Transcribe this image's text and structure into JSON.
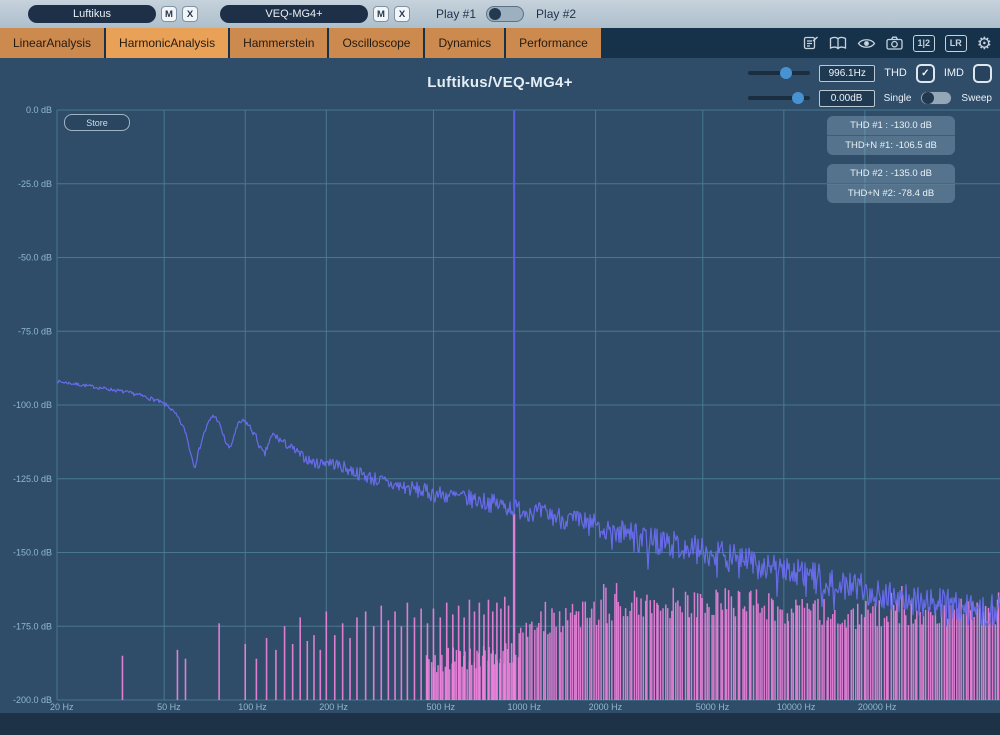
{
  "topbar": {
    "slot1": "Luftikus",
    "slot1_mute": "M",
    "slot1_close": "X",
    "slot2": "VEQ-MG4+",
    "slot2_mute": "M",
    "slot2_close": "X",
    "play1": "Play #1",
    "play2": "Play #2"
  },
  "tabs": {
    "t0": "LinearAnalysis",
    "t1": "HarmonicAnalysis",
    "t2": "Hammerstein",
    "t3": "Oscilloscope",
    "t4": "Dynamics",
    "t5": "Performance"
  },
  "toolbar": {
    "compare": "1|2",
    "channels": "LR",
    "gear": "⚙"
  },
  "header": {
    "title": "Luftikus/VEQ-MG4+"
  },
  "controls": {
    "freq": "996.1Hz",
    "thd": "THD",
    "thd_check": "✓",
    "imd": "IMD",
    "level": "0.00dB",
    "single": "Single",
    "sweep": "Sweep",
    "store": "Store"
  },
  "measurements": {
    "b1l1": "THD #1 : -130.0 dB",
    "b1l2": "THD+N #1: -106.5 dB",
    "b2l1": "THD #2 : -135.0 dB",
    "b2l2": "THD+N #2: -78.4 dB"
  },
  "colors": {
    "bg": "#2f4d69",
    "grid": "#4a7d96",
    "axis_text": "#8fb9cc",
    "curve": "#6b6df0",
    "spike": "#5a5ce8",
    "harmonics": "#ee82dc",
    "accent": "#e8a157"
  },
  "chart_data": {
    "type": "line",
    "title": "Luftikus/VEQ-MG4+",
    "x_axis": {
      "scale": "log",
      "unit": "Hz",
      "min": 20,
      "max": 63000,
      "ticks": [
        {
          "f": 20,
          "label": "20 Hz"
        },
        {
          "f": 50,
          "label": "50 Hz"
        },
        {
          "f": 100,
          "label": "100 Hz"
        },
        {
          "f": 200,
          "label": "200 Hz"
        },
        {
          "f": 500,
          "label": "500 Hz"
        },
        {
          "f": 1000,
          "label": "1000 Hz"
        },
        {
          "f": 2000,
          "label": "2000 Hz"
        },
        {
          "f": 5000,
          "label": "5000 Hz"
        },
        {
          "f": 10000,
          "label": "10000 Hz"
        },
        {
          "f": 20000,
          "label": "20000 Hz"
        }
      ]
    },
    "y_axis": {
      "unit": "dB",
      "min": -200,
      "max": 0,
      "step": 25,
      "ticks": [
        {
          "db": 0,
          "label": "0.0 dB"
        },
        {
          "db": -25,
          "label": "-25.0 dB"
        },
        {
          "db": -50,
          "label": "-50.0 dB"
        },
        {
          "db": -75,
          "label": "-75.0 dB"
        },
        {
          "db": -100,
          "label": "-100.0 dB"
        },
        {
          "db": -125,
          "label": "-125.0 dB"
        },
        {
          "db": -150,
          "label": "-150.0 dB"
        },
        {
          "db": -175,
          "label": "-175.0 dB"
        },
        {
          "db": -200,
          "label": "-200.0 dB"
        }
      ]
    },
    "fundamental": {
      "freq_hz": 996.1,
      "top_db": 0,
      "color": "#5a5ce8"
    },
    "noise_floor": {
      "color": "#6b6df0",
      "seed": 7,
      "envelope_db_points": [
        [
          20,
          -92
        ],
        [
          26,
          -93.5
        ],
        [
          33,
          -95
        ],
        [
          40,
          -96.5
        ],
        [
          47,
          -98.5
        ],
        [
          52,
          -100.5
        ],
        [
          56,
          -104
        ],
        [
          60,
          -109
        ],
        [
          63,
          -117
        ],
        [
          65,
          -121
        ],
        [
          67,
          -116
        ],
        [
          70,
          -110
        ],
        [
          73,
          -106
        ],
        [
          76,
          -103.5
        ],
        [
          79,
          -105
        ],
        [
          82,
          -109
        ],
        [
          85,
          -113
        ],
        [
          88,
          -115
        ],
        [
          91,
          -110
        ],
        [
          95,
          -106
        ],
        [
          100,
          -105.5
        ],
        [
          105,
          -108
        ],
        [
          110,
          -111
        ],
        [
          114,
          -115
        ],
        [
          118,
          -117
        ],
        [
          122,
          -113
        ],
        [
          127,
          -110
        ],
        [
          133,
          -111.5
        ],
        [
          140,
          -113
        ],
        [
          148,
          -114.5
        ],
        [
          158,
          -116.5
        ],
        [
          170,
          -118.5
        ],
        [
          185,
          -120
        ],
        [
          200,
          -119
        ],
        [
          230,
          -121
        ],
        [
          260,
          -123
        ],
        [
          300,
          -125
        ],
        [
          350,
          -127
        ],
        [
          420,
          -128.5
        ],
        [
          500,
          -130
        ],
        [
          600,
          -131
        ],
        [
          750,
          -132.5
        ],
        [
          900,
          -134
        ],
        [
          1000,
          -135
        ],
        [
          1300,
          -137
        ],
        [
          1700,
          -139.5
        ],
        [
          2000,
          -141
        ],
        [
          2600,
          -143.5
        ],
        [
          3300,
          -146
        ],
        [
          4200,
          -148
        ],
        [
          5000,
          -149.5
        ],
        [
          6500,
          -152
        ],
        [
          8000,
          -154
        ],
        [
          10000,
          -156
        ],
        [
          13000,
          -158.5
        ],
        [
          16000,
          -160.5
        ],
        [
          20000,
          -162.5
        ],
        [
          26000,
          -165
        ],
        [
          33000,
          -166.5
        ],
        [
          42000,
          -168
        ],
        [
          52000,
          -169
        ],
        [
          63000,
          -170
        ]
      ],
      "noise_amp_points": [
        [
          20,
          0.5
        ],
        [
          80,
          0.8
        ],
        [
          150,
          1.5
        ],
        [
          300,
          2.5
        ],
        [
          600,
          3
        ],
        [
          1200,
          3.5
        ],
        [
          3000,
          4.5
        ],
        [
          8000,
          5
        ],
        [
          63000,
          5.5
        ]
      ],
      "dip_chance": 0.12,
      "dip_max_db": 8,
      "dip_above_hz": 1800
    },
    "harmonics": {
      "color": "#ee82dc",
      "spikes": [
        [
          35,
          -185
        ],
        [
          56,
          -183
        ],
        [
          60,
          -186
        ],
        [
          80,
          -174
        ],
        [
          100,
          -181
        ],
        [
          110,
          -186
        ],
        [
          120,
          -179
        ],
        [
          130,
          -183
        ],
        [
          140,
          -175
        ],
        [
          150,
          -181
        ],
        [
          160,
          -172
        ],
        [
          170,
          -180
        ],
        [
          180,
          -178
        ],
        [
          190,
          -183
        ],
        [
          200,
          -170
        ],
        [
          215,
          -178
        ],
        [
          230,
          -174
        ],
        [
          245,
          -179
        ],
        [
          260,
          -172
        ],
        [
          280,
          -170
        ],
        [
          300,
          -175
        ],
        [
          320,
          -168
        ],
        [
          340,
          -173
        ],
        [
          360,
          -170
        ],
        [
          380,
          -175
        ],
        [
          400,
          -167
        ],
        [
          425,
          -172
        ],
        [
          450,
          -169
        ],
        [
          475,
          -174
        ],
        [
          500,
          -169
        ],
        [
          530,
          -172
        ],
        [
          560,
          -167
        ],
        [
          590,
          -171
        ],
        [
          620,
          -168
        ],
        [
          650,
          -172
        ],
        [
          680,
          -166
        ],
        [
          710,
          -170
        ],
        [
          740,
          -167
        ],
        [
          770,
          -171
        ],
        [
          800,
          -166
        ],
        [
          830,
          -170
        ],
        [
          860,
          -167
        ],
        [
          890,
          -169
        ],
        [
          920,
          -165
        ],
        [
          950,
          -168
        ],
        [
          996.1,
          -137
        ]
      ],
      "comb": {
        "from_hz": 1040,
        "to_hz": 63000,
        "count": 218,
        "seed": 13,
        "jitter_db": 5,
        "tall_chance": 0.07,
        "tall_extra_db": 5,
        "envelope_db_points": [
          [
            1040,
            -176
          ],
          [
            1400,
            -173
          ],
          [
            2000,
            -170
          ],
          [
            3000,
            -167
          ],
          [
            4500,
            -168
          ],
          [
            6000,
            -167
          ],
          [
            8000,
            -168
          ],
          [
            11000,
            -169.5
          ],
          [
            16000,
            -171
          ],
          [
            22000,
            -171
          ],
          [
            30000,
            -170
          ],
          [
            42000,
            -170.5
          ],
          [
            63000,
            -170
          ]
        ]
      },
      "subcomb": {
        "from_hz": 470,
        "to_hz": 1030,
        "count": 55,
        "seed": 5,
        "jitter_db": 4,
        "envelope_db_points": [
          [
            470,
            -187
          ],
          [
            1030,
            -184
          ]
        ]
      }
    }
  }
}
